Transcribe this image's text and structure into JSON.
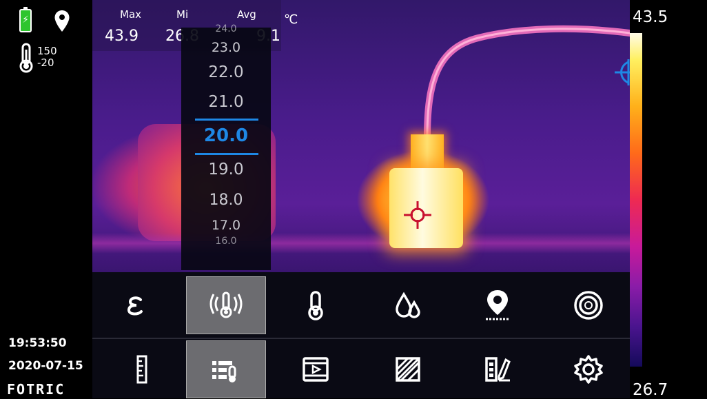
{
  "status": {
    "battery_glyph": "⚡",
    "range_high": "150",
    "range_low": "-20",
    "time": "19:53:50",
    "date": "2020-07-15",
    "brand": "FOTRIC"
  },
  "readout": {
    "max_label": "Max",
    "max_value": "43.9",
    "min_label": "Mi",
    "min_value": "26.8",
    "avg_label": "Avg",
    "avg_value": "9.1",
    "unit": "℃"
  },
  "picker": {
    "values": [
      "24.0",
      "23.0",
      "22.0",
      "21.0",
      "20.0",
      "19.0",
      "18.0",
      "17.0",
      "16.0"
    ],
    "selected": "20.0"
  },
  "scale": {
    "max": "43.5",
    "min": "26.7"
  },
  "colors": {
    "accent": "#1e88e5",
    "spot_marker": "#c8102e",
    "target_marker": "#1e88e5"
  },
  "menu": {
    "top_row": [
      "emissivity-icon",
      "reflected-temperature-icon",
      "ambient-temperature-icon",
      "humidity-icon",
      "distance-icon",
      "lens-icon"
    ],
    "bottom_row": [
      "ruler-icon",
      "measurement-tools-icon",
      "video-icon",
      "region-icon",
      "palette-edit-icon",
      "settings-icon"
    ],
    "selected_index": 1
  }
}
